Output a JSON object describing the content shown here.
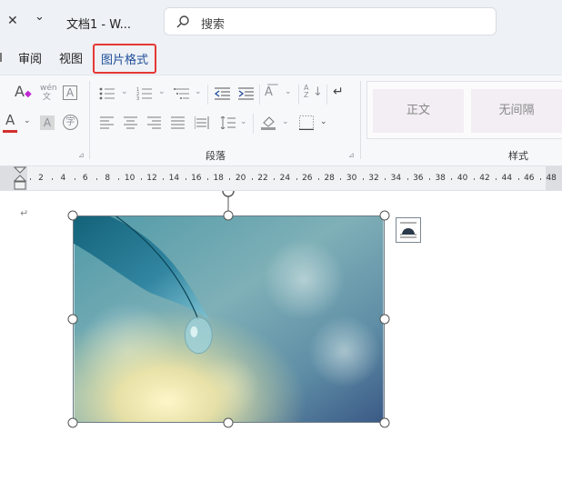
{
  "titlebar": {
    "close_glyph": "✕",
    "dropdown_glyph": "⌄",
    "doc_title": "文档1 - W...",
    "search_placeholder": "搜索"
  },
  "tabs": [
    {
      "label": "审阅",
      "active": false
    },
    {
      "label": "视图",
      "active": false
    },
    {
      "label": "图片格式",
      "active": true
    }
  ],
  "ribbon": {
    "font_color_glyph": "A",
    "paragraph_label": "段落",
    "styles_label": "样式",
    "styles": [
      "正文",
      "无间隔"
    ]
  },
  "ruler": {
    "numbers": [
      "2",
      "4",
      "6",
      "8",
      "10",
      "12",
      "14",
      "16",
      "18",
      "20",
      "22",
      "24",
      "26",
      "28",
      "30",
      "32",
      "34",
      "36",
      "38",
      "40",
      "42",
      "44",
      "46",
      "48"
    ]
  },
  "document": {
    "paragraph_mark": "↵"
  },
  "colors": {
    "accent": "#1f4e9a",
    "highlight_border": "#e53935",
    "font_color_bar": "#d32f2f"
  }
}
